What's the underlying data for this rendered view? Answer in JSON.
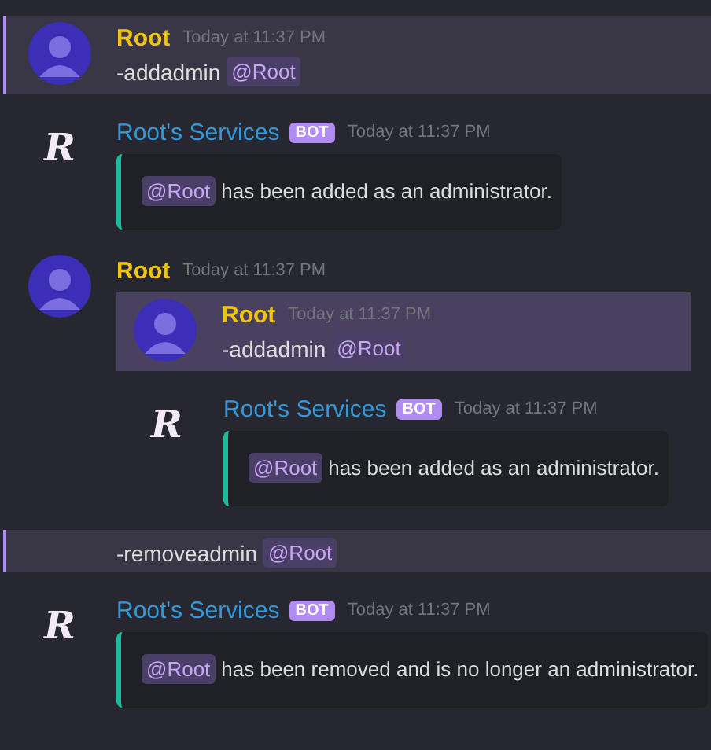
{
  "messages": [
    {
      "kind": "user",
      "highlighted": true,
      "author": "Root",
      "timestamp": "Today at 11:37 PM",
      "command": "-addadmin",
      "mention": "@Root"
    },
    {
      "kind": "bot",
      "avatar_letter": "R",
      "author": "Root's Services",
      "badge": "BOT",
      "timestamp": "Today at 11:37 PM",
      "embed": {
        "mention": "@Root",
        "text": "has been added as an administrator."
      }
    },
    {
      "kind": "user",
      "highlighted": false,
      "author": "Root",
      "timestamp": "Today at 11:37 PM",
      "children": [
        {
          "kind": "user",
          "highlighted": true,
          "author": "Root",
          "timestamp": "Today at 11:37 PM",
          "command": "-addadmin",
          "mention": "@Root"
        },
        {
          "kind": "bot",
          "avatar_letter": "R",
          "author": "Root's Services",
          "badge": "BOT",
          "timestamp": "Today at 11:37 PM",
          "embed": {
            "mention": "@Root",
            "text": "has been added as an administrator."
          }
        }
      ]
    },
    {
      "kind": "continuation",
      "highlighted": true,
      "command": "-removeadmin",
      "mention": "@Root"
    },
    {
      "kind": "bot",
      "avatar_letter": "R",
      "author": "Root's Services",
      "badge": "BOT",
      "timestamp": "Today at 11:37 PM",
      "embed": {
        "mention": "@Root",
        "text": "has been removed and is no longer an administrator."
      }
    }
  ]
}
